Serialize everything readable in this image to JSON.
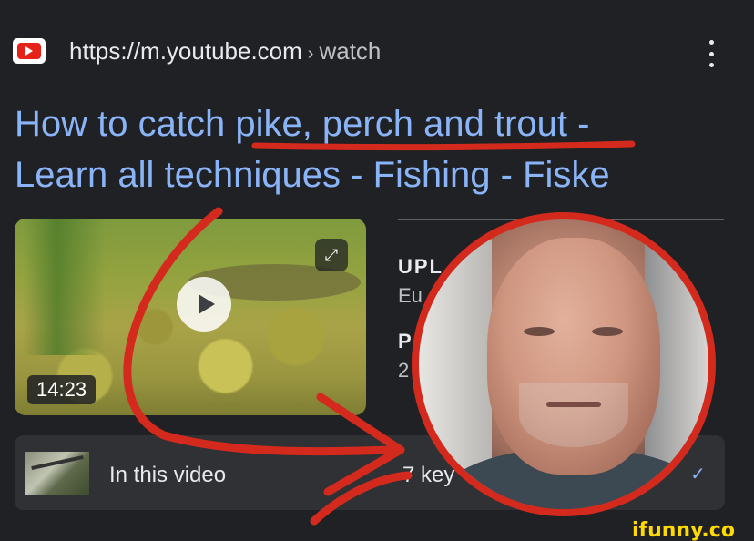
{
  "header": {
    "url": "https://m.youtube.com",
    "separator": "›",
    "path": "watch"
  },
  "result": {
    "title_line1": "How to catch pike, perch and trout -",
    "title_line2": "Learn all techniques - Fishing - Fiske"
  },
  "video": {
    "duration": "14:23",
    "expand_glyph": "⤢"
  },
  "meta": {
    "upload_label": "UPL",
    "upload_value": "Eu",
    "pub_label": "P",
    "pub_value": "2"
  },
  "bottom": {
    "in_this_video": "In this video",
    "key_moments": "7 key",
    "check_glyph": "✓"
  },
  "watermark": "ifunny.co",
  "colors": {
    "link": "#8ab4f8",
    "background": "#202124",
    "annotation_red": "#d42a1e",
    "youtube_red": "#e62117"
  },
  "icons": [
    "youtube-logo-icon",
    "more-vert-icon",
    "play-icon",
    "expand-icon",
    "checkmark-icon"
  ]
}
